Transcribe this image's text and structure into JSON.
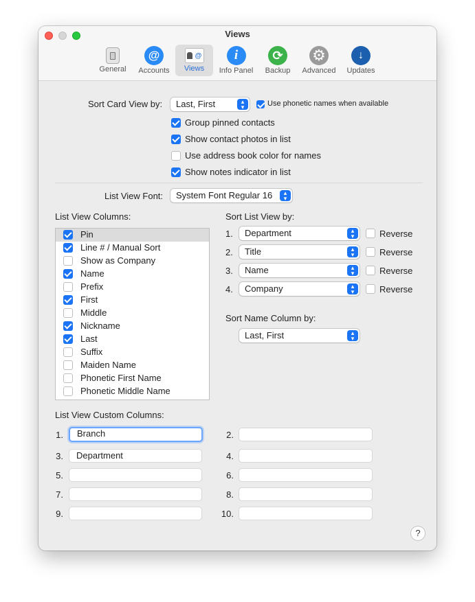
{
  "window": {
    "title": "Views"
  },
  "toolbar": {
    "tabs": [
      {
        "label": "General",
        "icon": "switch-icon"
      },
      {
        "label": "Accounts",
        "icon": "at-icon"
      },
      {
        "label": "Views",
        "icon": "contact-card-icon",
        "selected": true
      },
      {
        "label": "Info Panel",
        "icon": "info-icon"
      },
      {
        "label": "Backup",
        "icon": "backup-icon"
      },
      {
        "label": "Advanced",
        "icon": "gear-icon"
      },
      {
        "label": "Updates",
        "icon": "download-icon"
      }
    ]
  },
  "card_view": {
    "sort_label": "Sort Card View by:",
    "sort_value": "Last, First",
    "phonetic_label": "Use phonetic names when available",
    "phonetic_checked": true,
    "options": [
      {
        "label": "Group pinned contacts",
        "checked": true
      },
      {
        "label": "Show contact photos in list",
        "checked": true
      },
      {
        "label": "Use address book color for names",
        "checked": false
      },
      {
        "label": "Show notes indicator in list",
        "checked": true
      }
    ]
  },
  "font": {
    "label": "List View Font:",
    "value": "System Font Regular 16"
  },
  "columns": {
    "label": "List View Columns:",
    "items": [
      {
        "label": "Pin",
        "checked": true
      },
      {
        "label": "Line # / Manual Sort",
        "checked": true
      },
      {
        "label": "Show as Company",
        "checked": false
      },
      {
        "label": "Name",
        "checked": true
      },
      {
        "label": "Prefix",
        "checked": false
      },
      {
        "label": "First",
        "checked": true
      },
      {
        "label": "Middle",
        "checked": false
      },
      {
        "label": "Nickname",
        "checked": true
      },
      {
        "label": "Last",
        "checked": true
      },
      {
        "label": "Suffix",
        "checked": false
      },
      {
        "label": "Maiden Name",
        "checked": false
      },
      {
        "label": "Phonetic First Name",
        "checked": false
      },
      {
        "label": "Phonetic Middle Name",
        "checked": false
      }
    ]
  },
  "sort_list": {
    "label": "Sort List View by:",
    "reverse_label": "Reverse",
    "rows": [
      {
        "num": "1.",
        "value": "Department",
        "reverse": false
      },
      {
        "num": "2.",
        "value": "Title",
        "reverse": false
      },
      {
        "num": "3.",
        "value": "Name",
        "reverse": false
      },
      {
        "num": "4.",
        "value": "Company",
        "reverse": false
      }
    ]
  },
  "sort_name": {
    "label": "Sort Name Column by:",
    "value": "Last, First"
  },
  "custom": {
    "label": "List View Custom Columns:",
    "fields": [
      {
        "num": "1.",
        "value": "Branch"
      },
      {
        "num": "2.",
        "value": ""
      },
      {
        "num": "3.",
        "value": "Department"
      },
      {
        "num": "4.",
        "value": ""
      },
      {
        "num": "5.",
        "value": ""
      },
      {
        "num": "6.",
        "value": ""
      },
      {
        "num": "7.",
        "value": ""
      },
      {
        "num": "8.",
        "value": ""
      },
      {
        "num": "9.",
        "value": ""
      },
      {
        "num": "10.",
        "value": ""
      }
    ]
  },
  "help": {
    "label": "?"
  },
  "colors": {
    "accent": "#1a74f5",
    "focus": "#6aa5ff"
  }
}
